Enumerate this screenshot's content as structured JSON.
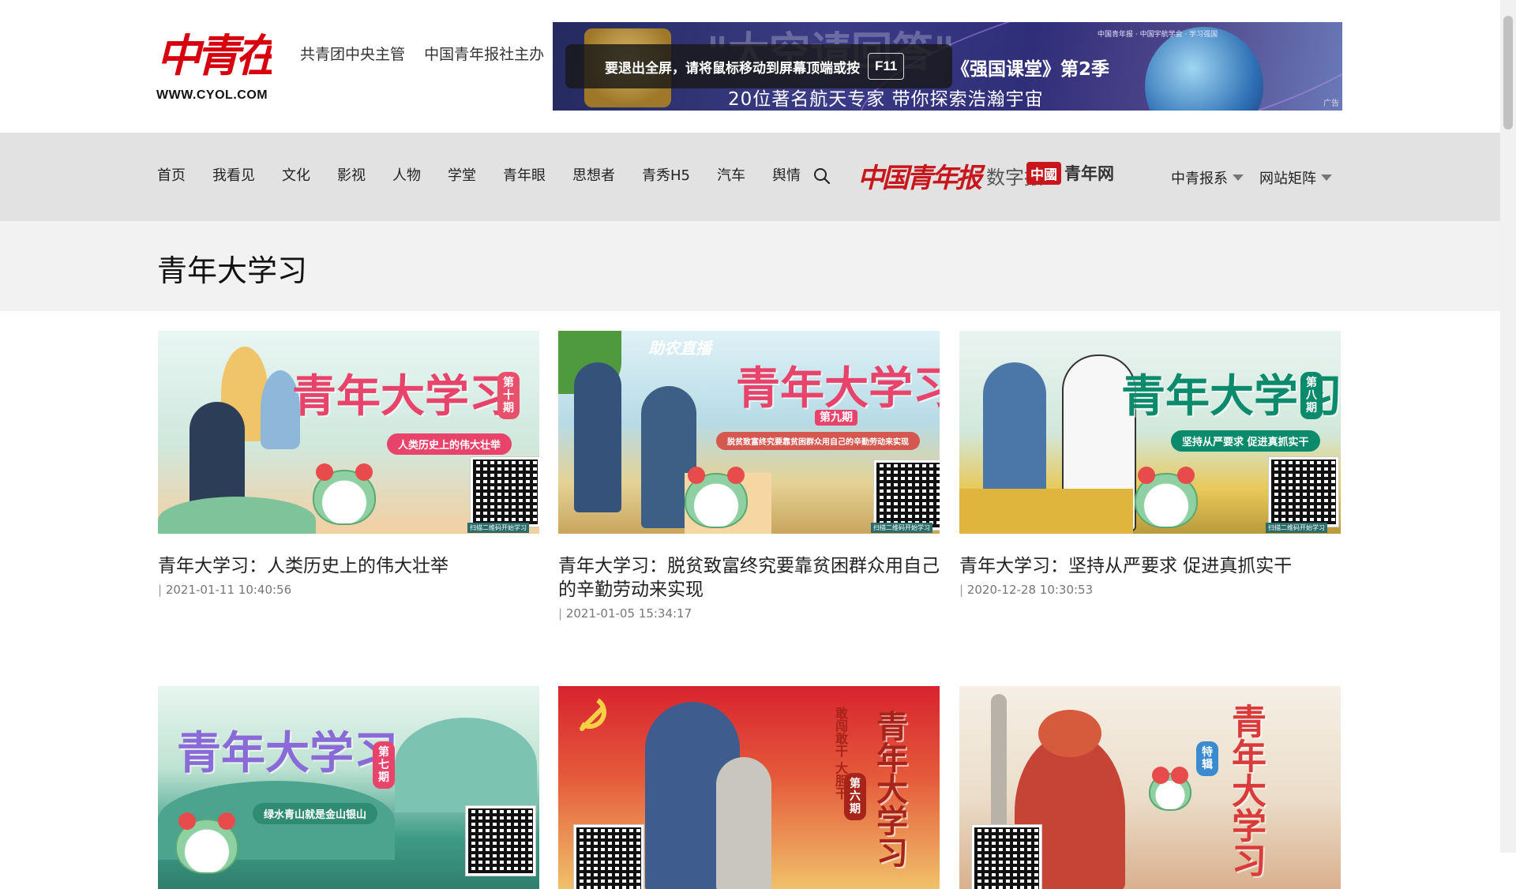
{
  "header": {
    "logo_mark": "中青在线",
    "logo_url": "WWW.CYOL.COM",
    "org_1": "共青团中央主管",
    "org_2": "中国青年报社主办"
  },
  "banner": {
    "bigtitle": "\"太空请回答\"",
    "line1": "《强国课堂》第2季",
    "line2": "20位著名航天专家  带你探索浩瀚宇宙",
    "sponsors": "中国青年报 · 中国宇航学会 · 学习强国",
    "ad_label": "广告",
    "fullscreen_tip": "要退出全屏，请将鼠标移动到屏幕顶端或按",
    "fullscreen_key": "F11"
  },
  "nav": {
    "items": [
      "首页",
      "我看见",
      "文化",
      "影视",
      "人物",
      "学堂",
      "青年眼",
      "思想者",
      "青秀H5",
      "汽车",
      "舆情"
    ],
    "digital_logo": "中国青年报",
    "digital_text": "数字报",
    "cy_badge": "中國",
    "cy_text": "青年网",
    "dropdown_1": "中青报系",
    "dropdown_2": "网站矩阵"
  },
  "page": {
    "title": "青年大学习"
  },
  "cards": [
    {
      "title": "青年大学习：人类历史上的伟大壮举",
      "date": "2021-01-11 10:40:56",
      "thumb": {
        "title": "青年大学习",
        "badge": "第十期",
        "sub": "人类历史上的伟大壮举",
        "qr_caption": "扫描二维码开始学习"
      }
    },
    {
      "title": "青年大学习：脱贫致富终究要靠贫困群众用自己的辛勤劳动来实现",
      "date": "2021-01-05 15:34:17",
      "thumb": {
        "title": "青年大学习",
        "badge": "第九期",
        "tag": "助农直播",
        "sub": "脱贫致富终究要靠贫困群众用自己的辛勤劳动来实现",
        "qr_caption": "扫描二维码开始学习"
      }
    },
    {
      "title": "青年大学习：坚持从严要求 促进真抓实干",
      "date": "2020-12-28 10:30:53",
      "thumb": {
        "title": "青年大学习",
        "badge": "第八期",
        "sub": "坚持从严要求  促进真抓实干",
        "qr_caption": "扫描二维码开始学习"
      }
    },
    {
      "title": "",
      "date": "",
      "thumb": {
        "title": "青年大学习",
        "badge": "第七期",
        "sub": "绿水青山就是金山银山"
      }
    },
    {
      "title": "",
      "date": "",
      "thumb": {
        "title": "青年大学习",
        "badge": "第六期",
        "tag": "敢闯敢干 大胆干"
      }
    },
    {
      "title": "",
      "date": "",
      "thumb": {
        "title": "青年大学习",
        "badge": "特辑"
      }
    }
  ],
  "colors": {
    "brand_red": "#d7000f",
    "nav_bg": "#e2e2e2",
    "title_band": "#f2f2f2"
  }
}
